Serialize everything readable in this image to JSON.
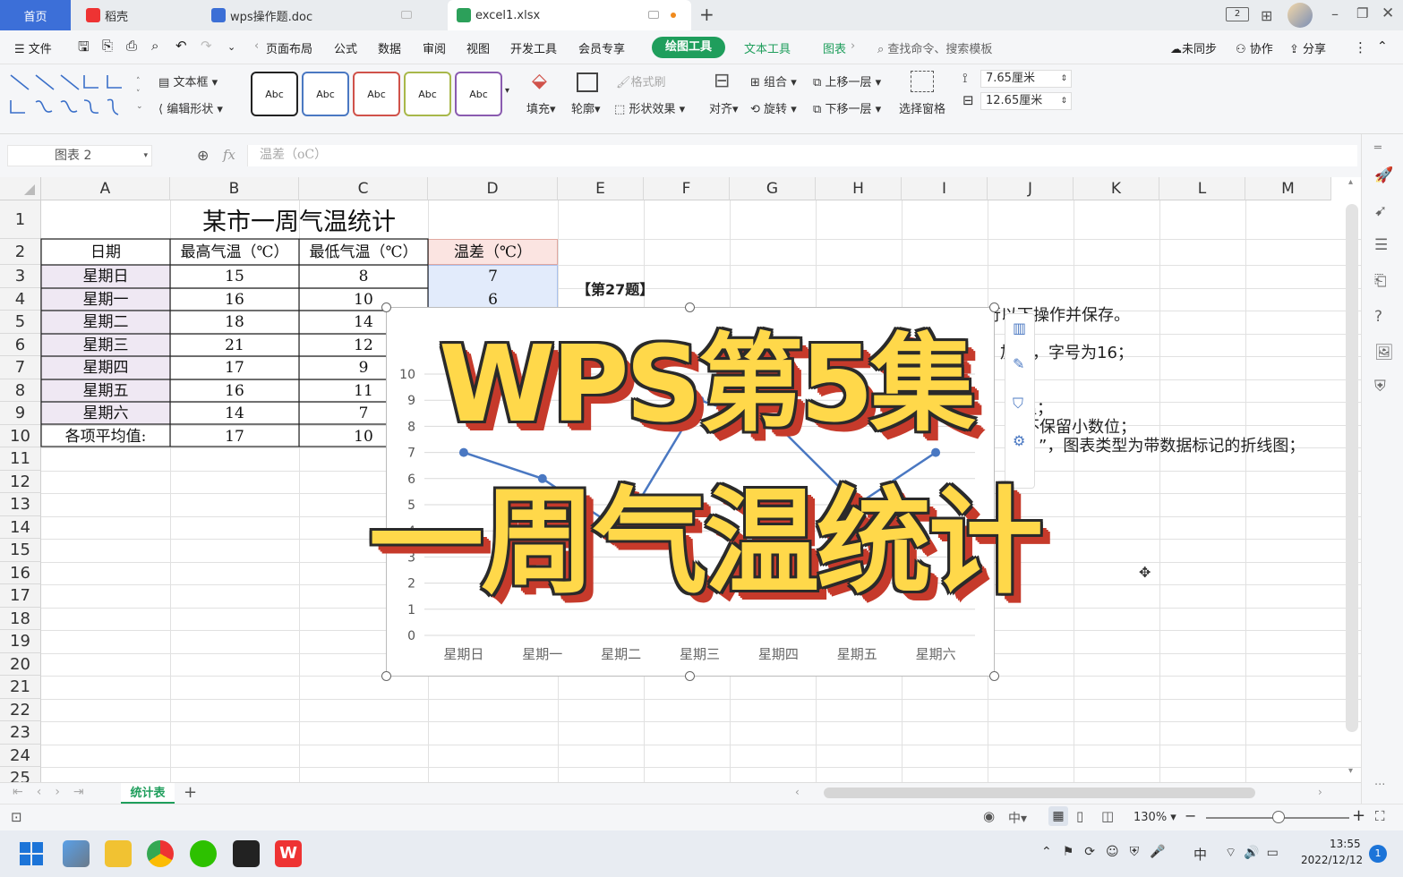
{
  "tabs": {
    "home": "首页",
    "daoke": "稻壳",
    "doc": "wps操作题.doc",
    "xlsx": "excel1.xlsx",
    "new_tab": "+"
  },
  "menubar": {
    "file": "文件",
    "items": [
      "页面布局",
      "公式",
      "数据",
      "审阅",
      "视图",
      "开发工具",
      "会员专享"
    ],
    "drawing_tools": "绘图工具",
    "text_tools": "文本工具",
    "chart_tools": "图表",
    "search": "查找命令、搜索模板",
    "unsynced": "未同步",
    "collab": "协作",
    "share": "分享"
  },
  "ribbon": {
    "textbox": "文本框",
    "edit_shape": "编辑形状",
    "style_label": "Abc",
    "style_colors": [
      "#222222",
      "#4a78c2",
      "#d0524a",
      "#a8b84a",
      "#8a5bb0"
    ],
    "fill": "填充",
    "outline": "轮廓",
    "format_brush": "格式刷",
    "shape_effect": "形状效果",
    "align": "对齐",
    "group": "组合",
    "rotate": "旋转",
    "bring_forward": "上移一层",
    "send_backward": "下移一层",
    "select_pane": "选择窗格",
    "height": "7.65厘米",
    "width": "12.65厘米"
  },
  "formula": {
    "name_box": "图表 2",
    "fx": "fx",
    "content": "温差（oC）"
  },
  "columns": [
    "A",
    "B",
    "C",
    "D",
    "E",
    "F",
    "G",
    "H",
    "I",
    "J",
    "K",
    "L",
    "M"
  ],
  "rows": [
    "1",
    "2",
    "3",
    "4",
    "5",
    "6",
    "7",
    "8",
    "9",
    "10",
    "11",
    "12",
    "13",
    "14",
    "15",
    "16",
    "17",
    "18",
    "19",
    "20",
    "21",
    "22",
    "23",
    "24",
    "25"
  ],
  "sheet": {
    "title": "某市一周气温统计",
    "headers": [
      "日期",
      "最高气温（℃）",
      "最低气温（℃）",
      "温差（℃）"
    ],
    "data": [
      [
        "星期日",
        "15",
        "8",
        "7"
      ],
      [
        "星期一",
        "16",
        "10",
        "6"
      ],
      [
        "星期二",
        "18",
        "14",
        ""
      ],
      [
        "星期三",
        "21",
        "12",
        ""
      ],
      [
        "星期四",
        "17",
        "9",
        ""
      ],
      [
        "星期五",
        "16",
        "11",
        ""
      ],
      [
        "星期六",
        "14",
        "7",
        ""
      ]
    ],
    "avg_label": "各项平均值:",
    "avg": [
      "17",
      "10"
    ]
  },
  "task_text": {
    "tag": "【第27题】",
    "line1": "行以下操作并保存。",
    "line2": "加粗，字号为16；",
    "line3": "温；",
    "line4": "不保留小数位；",
    "line5": "”，图表类型为带数据标记的折线图；"
  },
  "chart_data": {
    "type": "line",
    "categories": [
      "星期日",
      "星期一",
      "星期二",
      "星期三",
      "星期四",
      "星期五",
      "星期六"
    ],
    "series": [
      {
        "values": [
          7,
          6,
          4,
          9,
          8,
          5,
          7
        ]
      }
    ],
    "y_ticks": [
      "0",
      "1",
      "2",
      "3",
      "4",
      "5",
      "6",
      "7",
      "8",
      "9",
      "10"
    ],
    "ylim": [
      0,
      10
    ],
    "grid": true,
    "color": "#4a78c2"
  },
  "overlay": {
    "line1": "WPS第5集",
    "line2": "一周气温统计"
  },
  "sheet_tabs": {
    "active": "统计表",
    "add": "+"
  },
  "status": {
    "zoom": "130%",
    "minus": "−",
    "plus": "+"
  },
  "taskbar": {
    "time": "13:55",
    "date": "2022/12/12",
    "ime": "中",
    "notif": "1"
  }
}
